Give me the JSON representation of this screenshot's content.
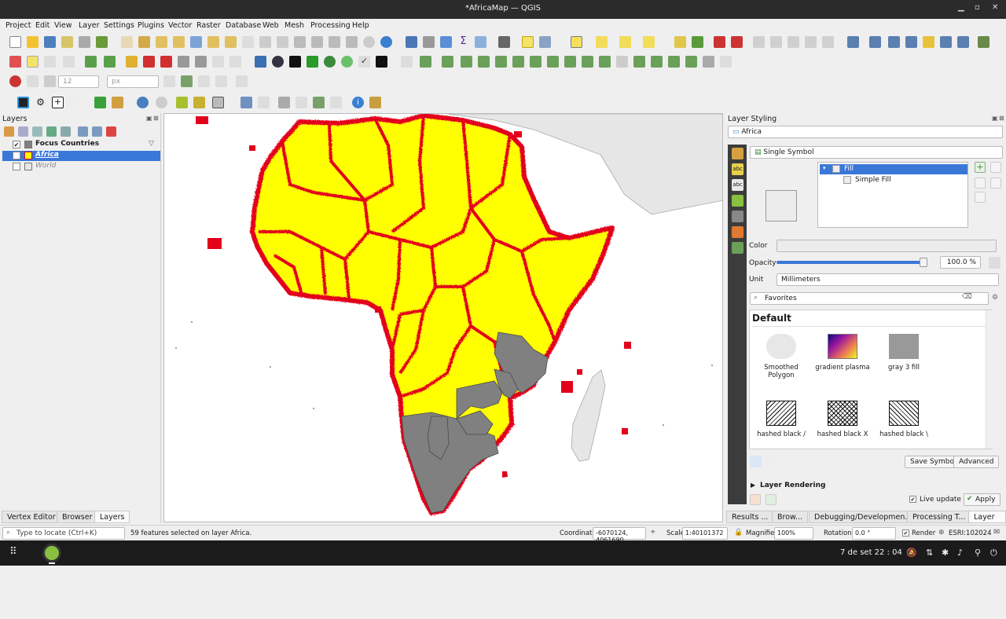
{
  "window": {
    "title": "*AfricaMap — QGIS"
  },
  "menu": [
    "Project",
    "Edit",
    "View",
    "Layer",
    "Settings",
    "Plugins",
    "Vector",
    "Raster",
    "Database",
    "Web",
    "Mesh",
    "Processing",
    "Help"
  ],
  "digitizing": {
    "size_value": "12",
    "size_unit": "px"
  },
  "layers_panel": {
    "title": "Layers",
    "layers": [
      {
        "name": "Focus Countries",
        "checked": "✔"
      },
      {
        "name": "Africa",
        "checked": "✔"
      },
      {
        "name": "World",
        "checked": ""
      }
    ],
    "tabs": [
      "Vertex Editor",
      "Browser",
      "Layers"
    ]
  },
  "styling": {
    "title": "Layer Styling",
    "layer": "Africa",
    "renderer": "Single Symbol",
    "tree": [
      "Fill",
      "Simple Fill"
    ],
    "color_label": "Color",
    "opacity_label": "Opacity",
    "opacity_value": "100.0 %",
    "unit_label": "Unit",
    "unit_value": "Millimeters",
    "search_value": "Favorites",
    "group_title": "Default",
    "symbols": [
      "Smoothed Polygon",
      "gradient  plasma",
      "gray 3 fill",
      "hashed black /",
      "hashed black X",
      "hashed black \\"
    ],
    "save_symbol": "Save Symbol...",
    "advanced": "Advanced",
    "layer_rendering": "Layer Rendering",
    "live_update": "Live update",
    "apply": "Apply"
  },
  "dock_tabs": [
    "Results ...",
    "Brow...",
    "Debugging/Developmen...",
    "Processing T...",
    "Layer ..."
  ],
  "status": {
    "locator_placeholder": "Type to locate (Ctrl+K)",
    "message": "59 features selected on layer Africa.",
    "coordinate_label": "Coordinate",
    "coordinate_value": "-6070124, 4061690",
    "scale_label": "Scale",
    "scale_value": "1:40101372",
    "magnifier_label": "Magnifier",
    "magnifier_value": "100%",
    "rotation_label": "Rotation",
    "rotation_value": "0.0 °",
    "render_label": "Render",
    "crs": "ESRI:102024"
  },
  "taskbar": {
    "clock": "7 de set  22 : 04"
  },
  "colors": {
    "selection": "#ffff00",
    "selection_outline": "#e3001b",
    "focus_fill": "#808080",
    "world_fill": "#e6e6e6",
    "highlight": "#3a78d8"
  }
}
